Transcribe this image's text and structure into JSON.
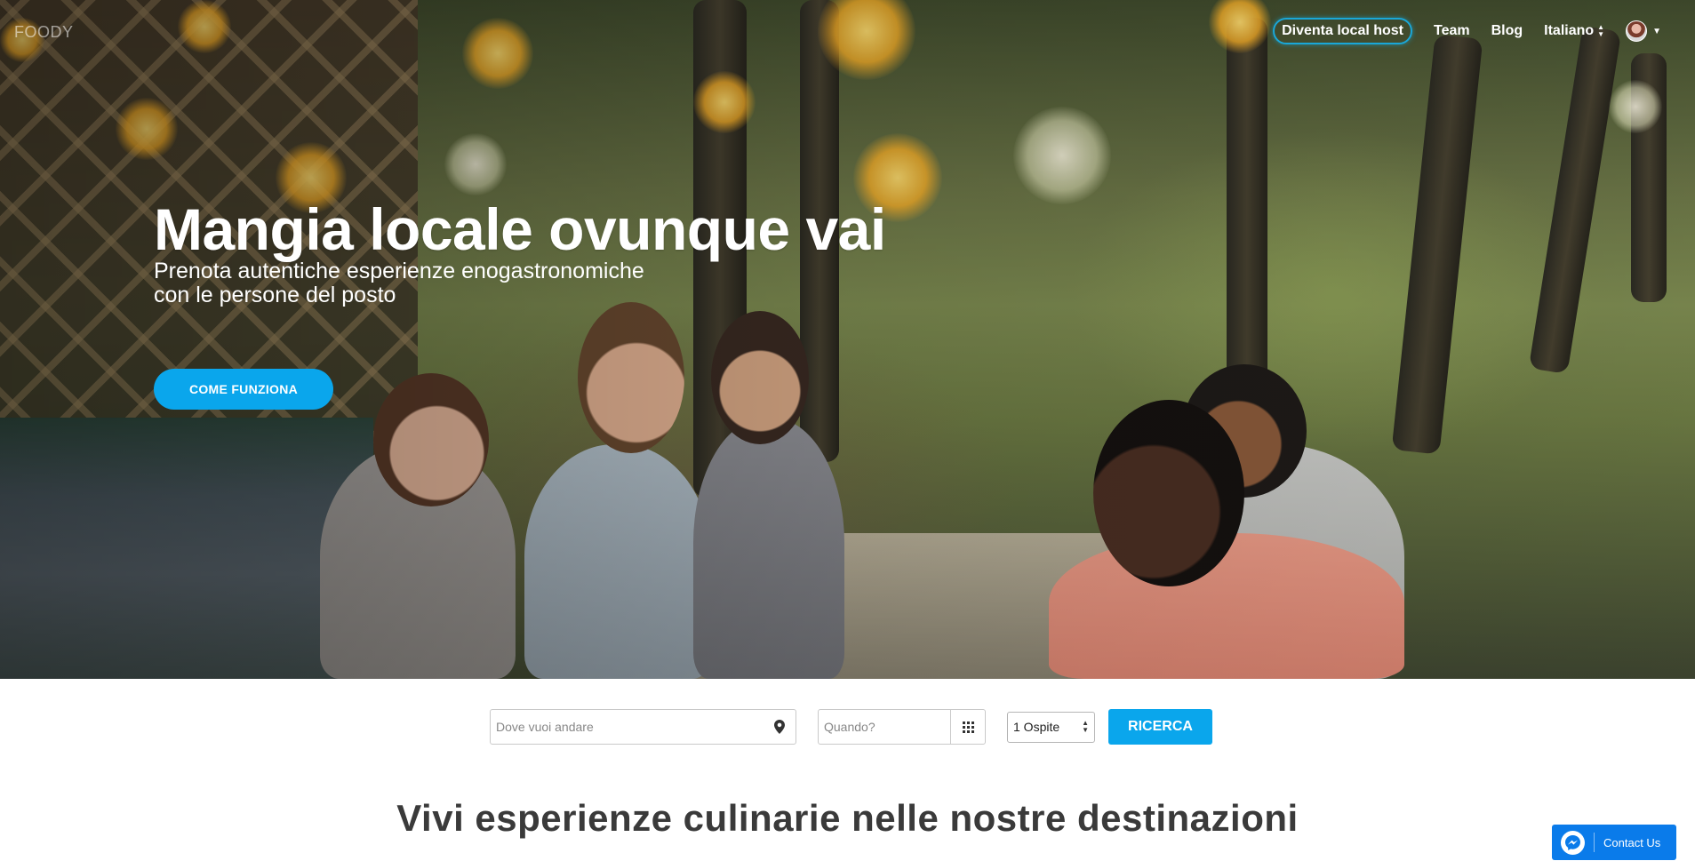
{
  "brand": {
    "logo": "FOODY"
  },
  "nav": {
    "host_link": "Diventa local host",
    "team_link": "Team",
    "blog_link": "Blog",
    "language": "Italiano"
  },
  "hero": {
    "title": "Mangia locale ovunque vai",
    "subtitle_line1": "Prenota autentiche esperienze enogastronomiche",
    "subtitle_line2": "con le persone del posto",
    "cta_label": "COME FUNZIONA"
  },
  "search": {
    "where_placeholder": "Dove vuoi andare",
    "when_placeholder": "Quando?",
    "guests_value": "1 Ospite",
    "button_label": "RICERCA"
  },
  "section": {
    "title": "Vivi esperienze culinarie nelle nostre destinazioni"
  },
  "contact": {
    "label": "Contact Us"
  },
  "colors": {
    "accent": "#0aa6ec",
    "contact": "#0a7bea",
    "host_outline": "#1aa7d8"
  },
  "icons": [
    "map-pin-icon",
    "calendar-grid-icon",
    "select-arrows-icon",
    "avatar",
    "caret-down-icon",
    "messenger-icon"
  ]
}
